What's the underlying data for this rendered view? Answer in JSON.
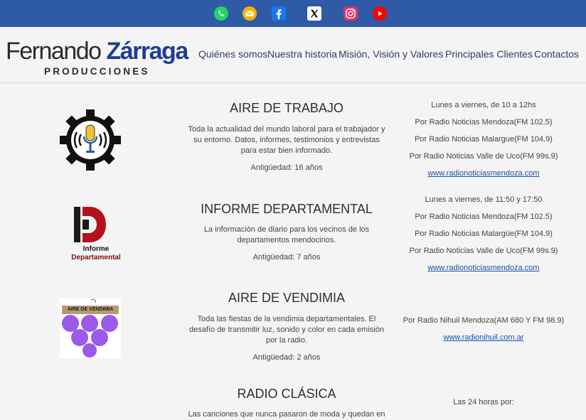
{
  "social": [
    {
      "name": "whatsapp-icon",
      "color": "#25d366"
    },
    {
      "name": "email-icon",
      "color": "#f5b400"
    },
    {
      "name": "facebook-icon",
      "color": "#1877f2"
    },
    {
      "name": "x-twitter-icon",
      "color": "#ffffff"
    },
    {
      "name": "instagram-icon",
      "color": "#e1306c"
    },
    {
      "name": "youtube-icon",
      "color": "#ff0000"
    }
  ],
  "brand": {
    "first": "Fernando ",
    "last": "Zárraga",
    "sub": "PRODUCCIONES",
    "colors": {
      "topbar": "#2f5aa6",
      "brand_blue": "#1f3e8f",
      "link": "#1a4fa8"
    }
  },
  "nav": [
    "Quiénes somos",
    "Nuestra historia",
    "Misión, Visión y Valores",
    "Principales Clientes",
    "Contactos"
  ],
  "shows": [
    {
      "title": "AIRE DE TRABAJO",
      "desc": [
        "Toda la actualidad del mundo laboral para el trabajador y",
        "su entorno. Datos, informes, testimonios y entrevistas",
        "para estar bien informado."
      ],
      "age": "Antigüedad: 16 años",
      "schedule": [
        "Lunes a viernes, de 10 a 12hs",
        "Por Radio Noticias Mendoza(FM 102.5)",
        "Por Radio Noticias Malargue(FM 104.9)",
        "Por Radio Noticias Valle de Uco(FM 99s.9)"
      ],
      "link": "www.radionoticiasmendoza.com"
    },
    {
      "title": "INFORME DEPARTAMENTAL",
      "logo_text": [
        "Informe",
        "Departamental"
      ],
      "desc": [
        "La información de diario para los vecinos de los",
        "departamentos mendocinos."
      ],
      "age": "Antigüedad: 7 años",
      "schedule": [
        "Lunes a viernes, de 11:50 y 17:50",
        "Por Radio Noticias Mendoza(FM 102.5)",
        "Por Radio Noticias Malargüe(FM 104.9)",
        "Por Radio Noticias Valle de Uco(FM 99s.9)"
      ],
      "link": "www.radionoticiasmendoza.com"
    },
    {
      "title": "AIRE DE VENDIMIA",
      "logo_text": [
        "AIRE DE VENDIMIA"
      ],
      "desc": [
        "Toda las fiestas de la vendimia departamentales. El",
        "desafío de transmitir luz, sonido y color en cada emisión",
        "por la radio."
      ],
      "age": "Antigüedad: 2 años",
      "schedule": [
        "Por Radio Nihuil Mendoza(AM 680 Y FM 98.9)"
      ],
      "link": "www.radionihuil.com.ar"
    },
    {
      "title": "RADIO CLÁSICA",
      "desc": [
        "Las canciones que nunca pasaron de moda y quedan en"
      ],
      "schedule": [
        "Las 24 horas por:"
      ]
    }
  ]
}
